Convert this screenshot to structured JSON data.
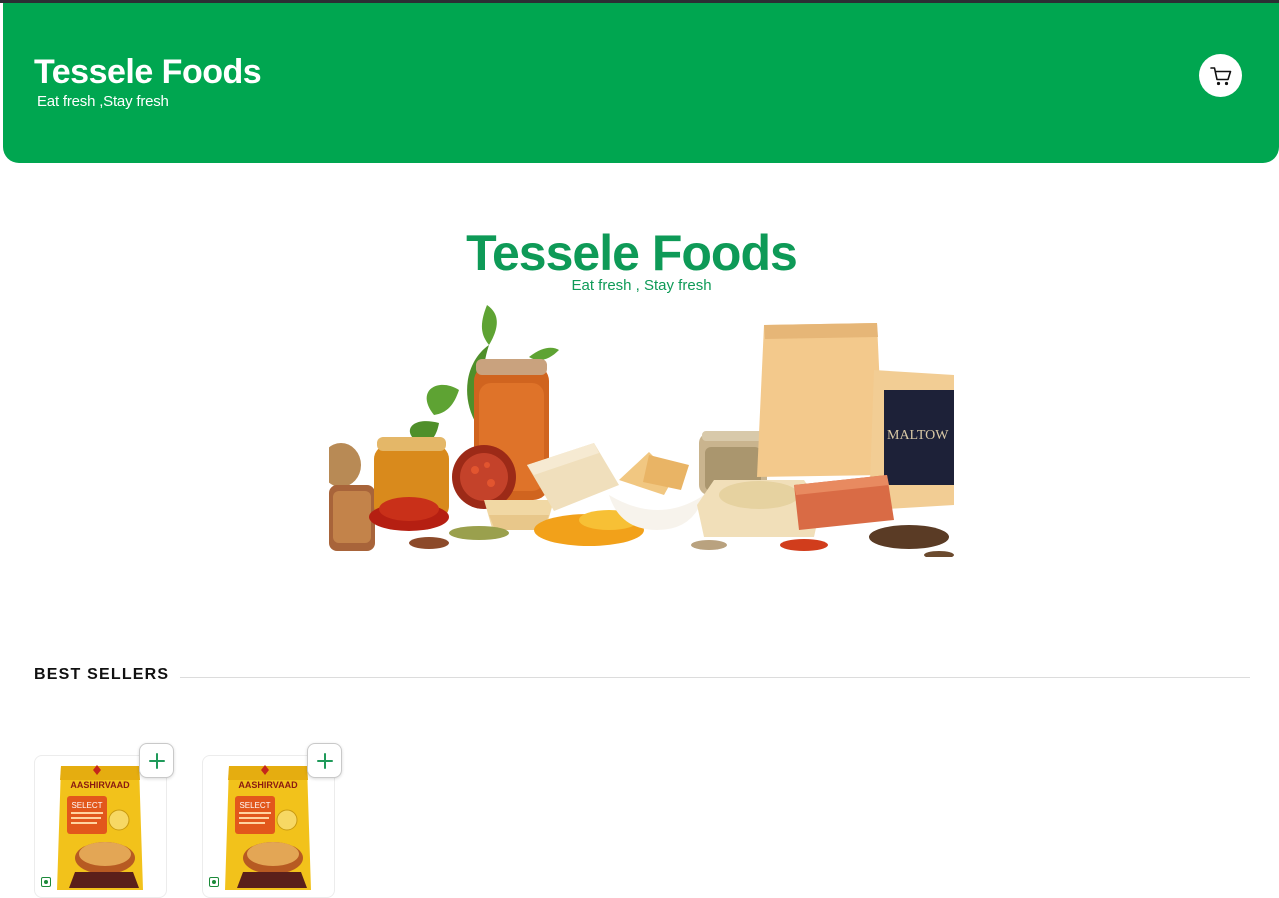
{
  "header": {
    "brand_title": "Tessele Foods",
    "tagline": "Eat fresh ,Stay fresh",
    "cart_icon": "cart-icon",
    "background_color": "#00a650"
  },
  "hero": {
    "title": "Tessele Foods",
    "tagline": "Eat fresh , Stay fresh",
    "brand_color": "#0e9a57"
  },
  "best_sellers": {
    "title": "BEST SELLERS",
    "products": [
      {
        "brand_text": "AASHIRVAAD",
        "variant_text": "SELECT",
        "add_icon": "plus-icon",
        "veg_icon": "veg-mark-icon"
      },
      {
        "brand_text": "AASHIRVAAD",
        "variant_text": "SELECT",
        "add_icon": "plus-icon",
        "veg_icon": "veg-mark-icon"
      }
    ]
  }
}
